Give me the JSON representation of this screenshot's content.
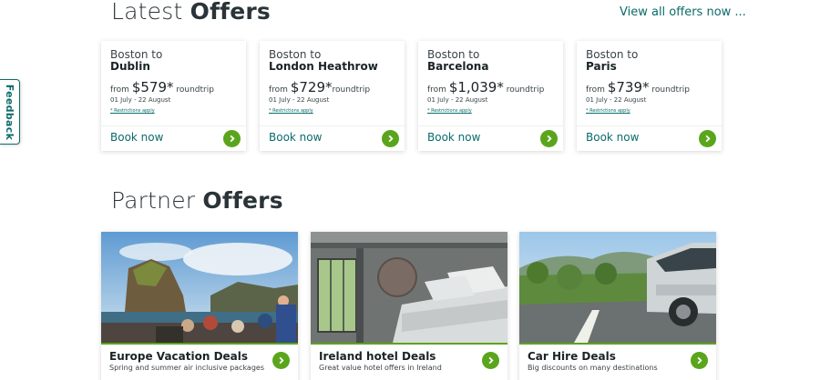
{
  "latest": {
    "title_light": "Latest",
    "title_bold": "Offers",
    "view_all": "View all offers now ..."
  },
  "feedback": "Feedback",
  "offers": [
    {
      "origin": "Boston to",
      "destination": "Dublin",
      "from": "from",
      "price": "$579",
      "asterisk": "*",
      "trip": "roundtrip",
      "dates": "01 July - 22 August",
      "restrictions": "* Restrictions apply",
      "book": "Book now"
    },
    {
      "origin": "Boston to",
      "destination": "London Heathrow",
      "from": "from",
      "price": "$729",
      "asterisk": "*",
      "trip": "roundtrip",
      "dates": "01 July - 22 August",
      "restrictions": "* Restrictions apply",
      "book": "Book now"
    },
    {
      "origin": "Boston to",
      "destination": "Barcelona",
      "from": "from",
      "price": "$1,039",
      "asterisk": "*",
      "trip": "roundtrip",
      "dates": "01 July - 22 August",
      "restrictions": "* Restrictions apply",
      "book": "Book now"
    },
    {
      "origin": "Boston to",
      "destination": "Paris",
      "from": "from",
      "price": "$739",
      "asterisk": "*",
      "trip": "roundtrip",
      "dates": "01 July - 22 August",
      "restrictions": "* Restrictions apply",
      "book": "Book now"
    }
  ],
  "partner": {
    "title_light": "Partner",
    "title_bold": "Offers",
    "cards": [
      {
        "title": "Europe Vacation Deals",
        "subtitle": "Spring and summer air inclusive packages",
        "image": "cliffs-of-moher-boat-photo"
      },
      {
        "title": "Ireland hotel Deals",
        "subtitle": "Great value hotel offers in Ireland",
        "image": "hotel-room-photo"
      },
      {
        "title": "Car Hire Deals",
        "subtitle": "Big discounts on many destinations",
        "image": "car-on-road-photo"
      }
    ]
  },
  "colors": {
    "accent_green": "#5aa51c",
    "link_teal": "#0b6b6b"
  }
}
